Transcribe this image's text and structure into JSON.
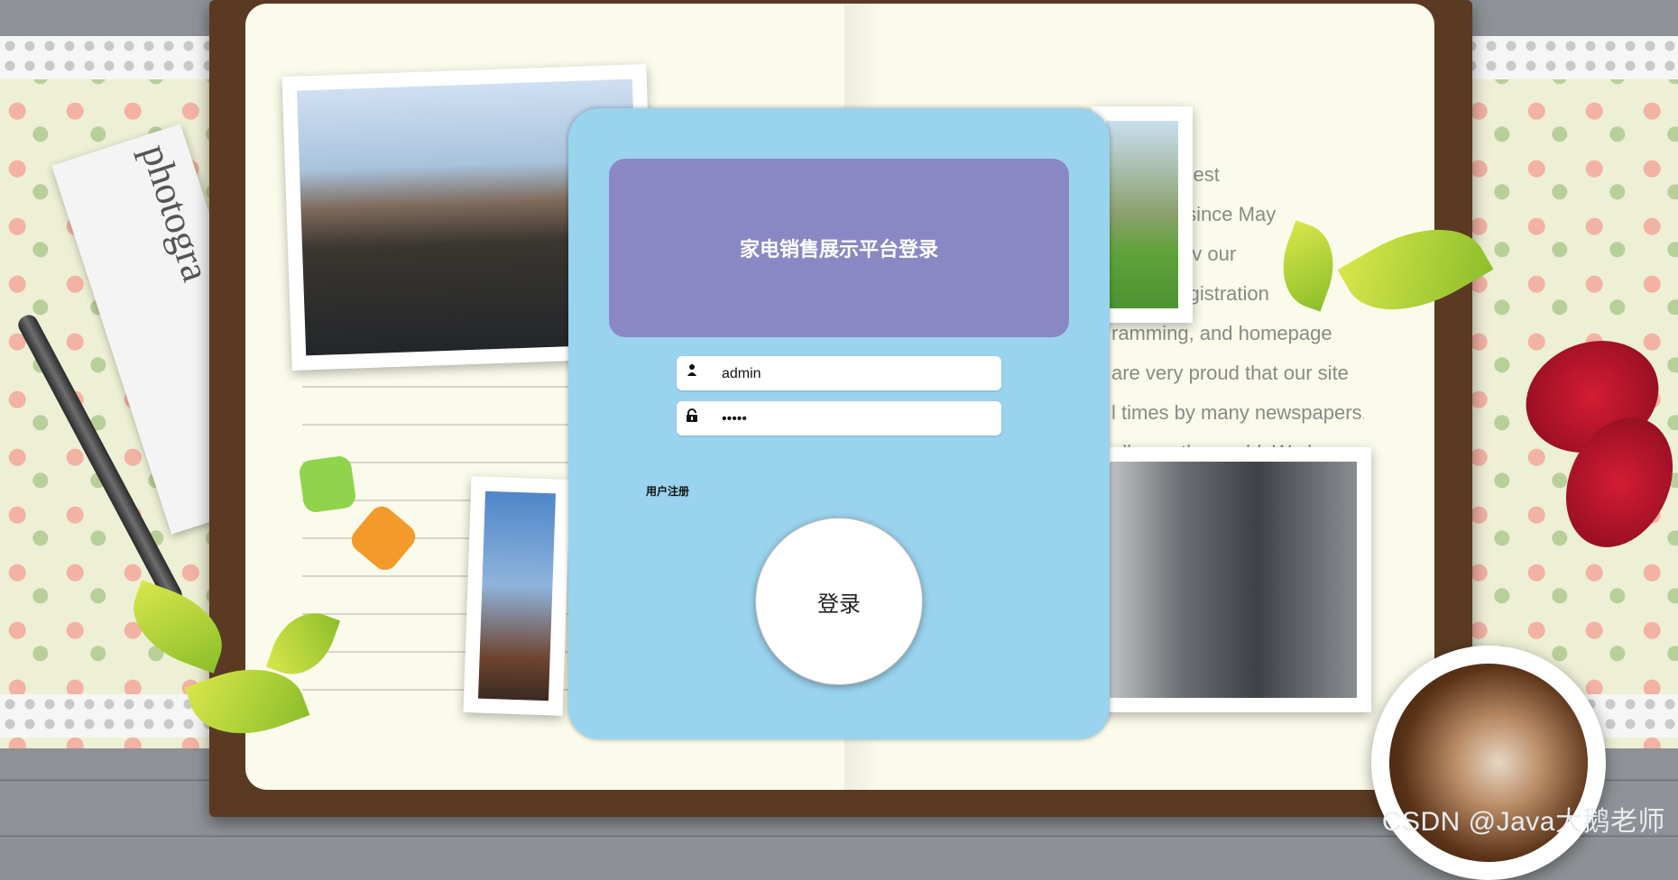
{
  "login": {
    "title": "家电销售展示平台登录",
    "username_value": "admin",
    "password_value": "•••••",
    "register_label": "用户注册",
    "login_label": "登录"
  },
  "background": {
    "newspaper_headline": "photogra",
    "page_text_lines": [
      "f the biggest",
      "n Korea since May",
      "ple have v         our",
      "omain registration",
      "ramming, and homepage",
      "are very proud that  our site",
      "l times by many newspapers,",
      "all over the world. We have"
    ]
  },
  "watermark": "CSDN @Java大鹅老师",
  "colors": {
    "panel_bg": "#9ad3ed",
    "title_bg": "#8a88c4"
  },
  "icons": {
    "username": "user-icon",
    "password": "lock-icon"
  }
}
